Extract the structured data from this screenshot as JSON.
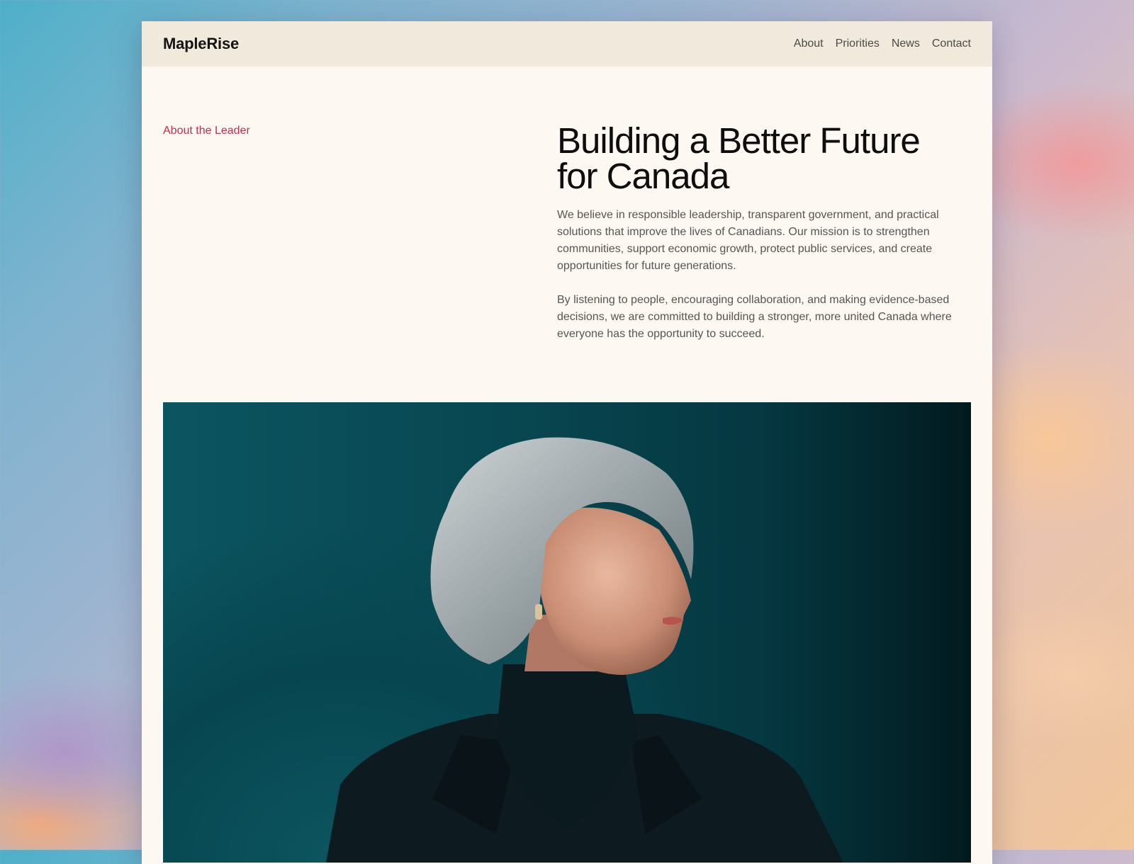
{
  "header": {
    "brand": "MapleRise",
    "nav": [
      "About",
      "Priorities",
      "News",
      "Contact"
    ]
  },
  "hero": {
    "eyebrow": "About the Leader",
    "title_line1": "Building a Better Future",
    "title_line2": "for Canada",
    "paragraph1": "We believe in responsible leadership, transparent government, and practical solutions that improve the lives of Canadians. Our mission is to strengthen communities, support economic growth, protect public services, and create opportunities for future generations.",
    "paragraph2": "By listening to people, encouraging collaboration, and making evidence-based decisions, we are committed to building a stronger, more united Canada where everyone has the opportunity to succeed."
  },
  "colors": {
    "accent": "#c0304f",
    "header_bg": "#f1e9dc",
    "page_bg": "#fdf8f1",
    "photo_bg": "#084650"
  }
}
